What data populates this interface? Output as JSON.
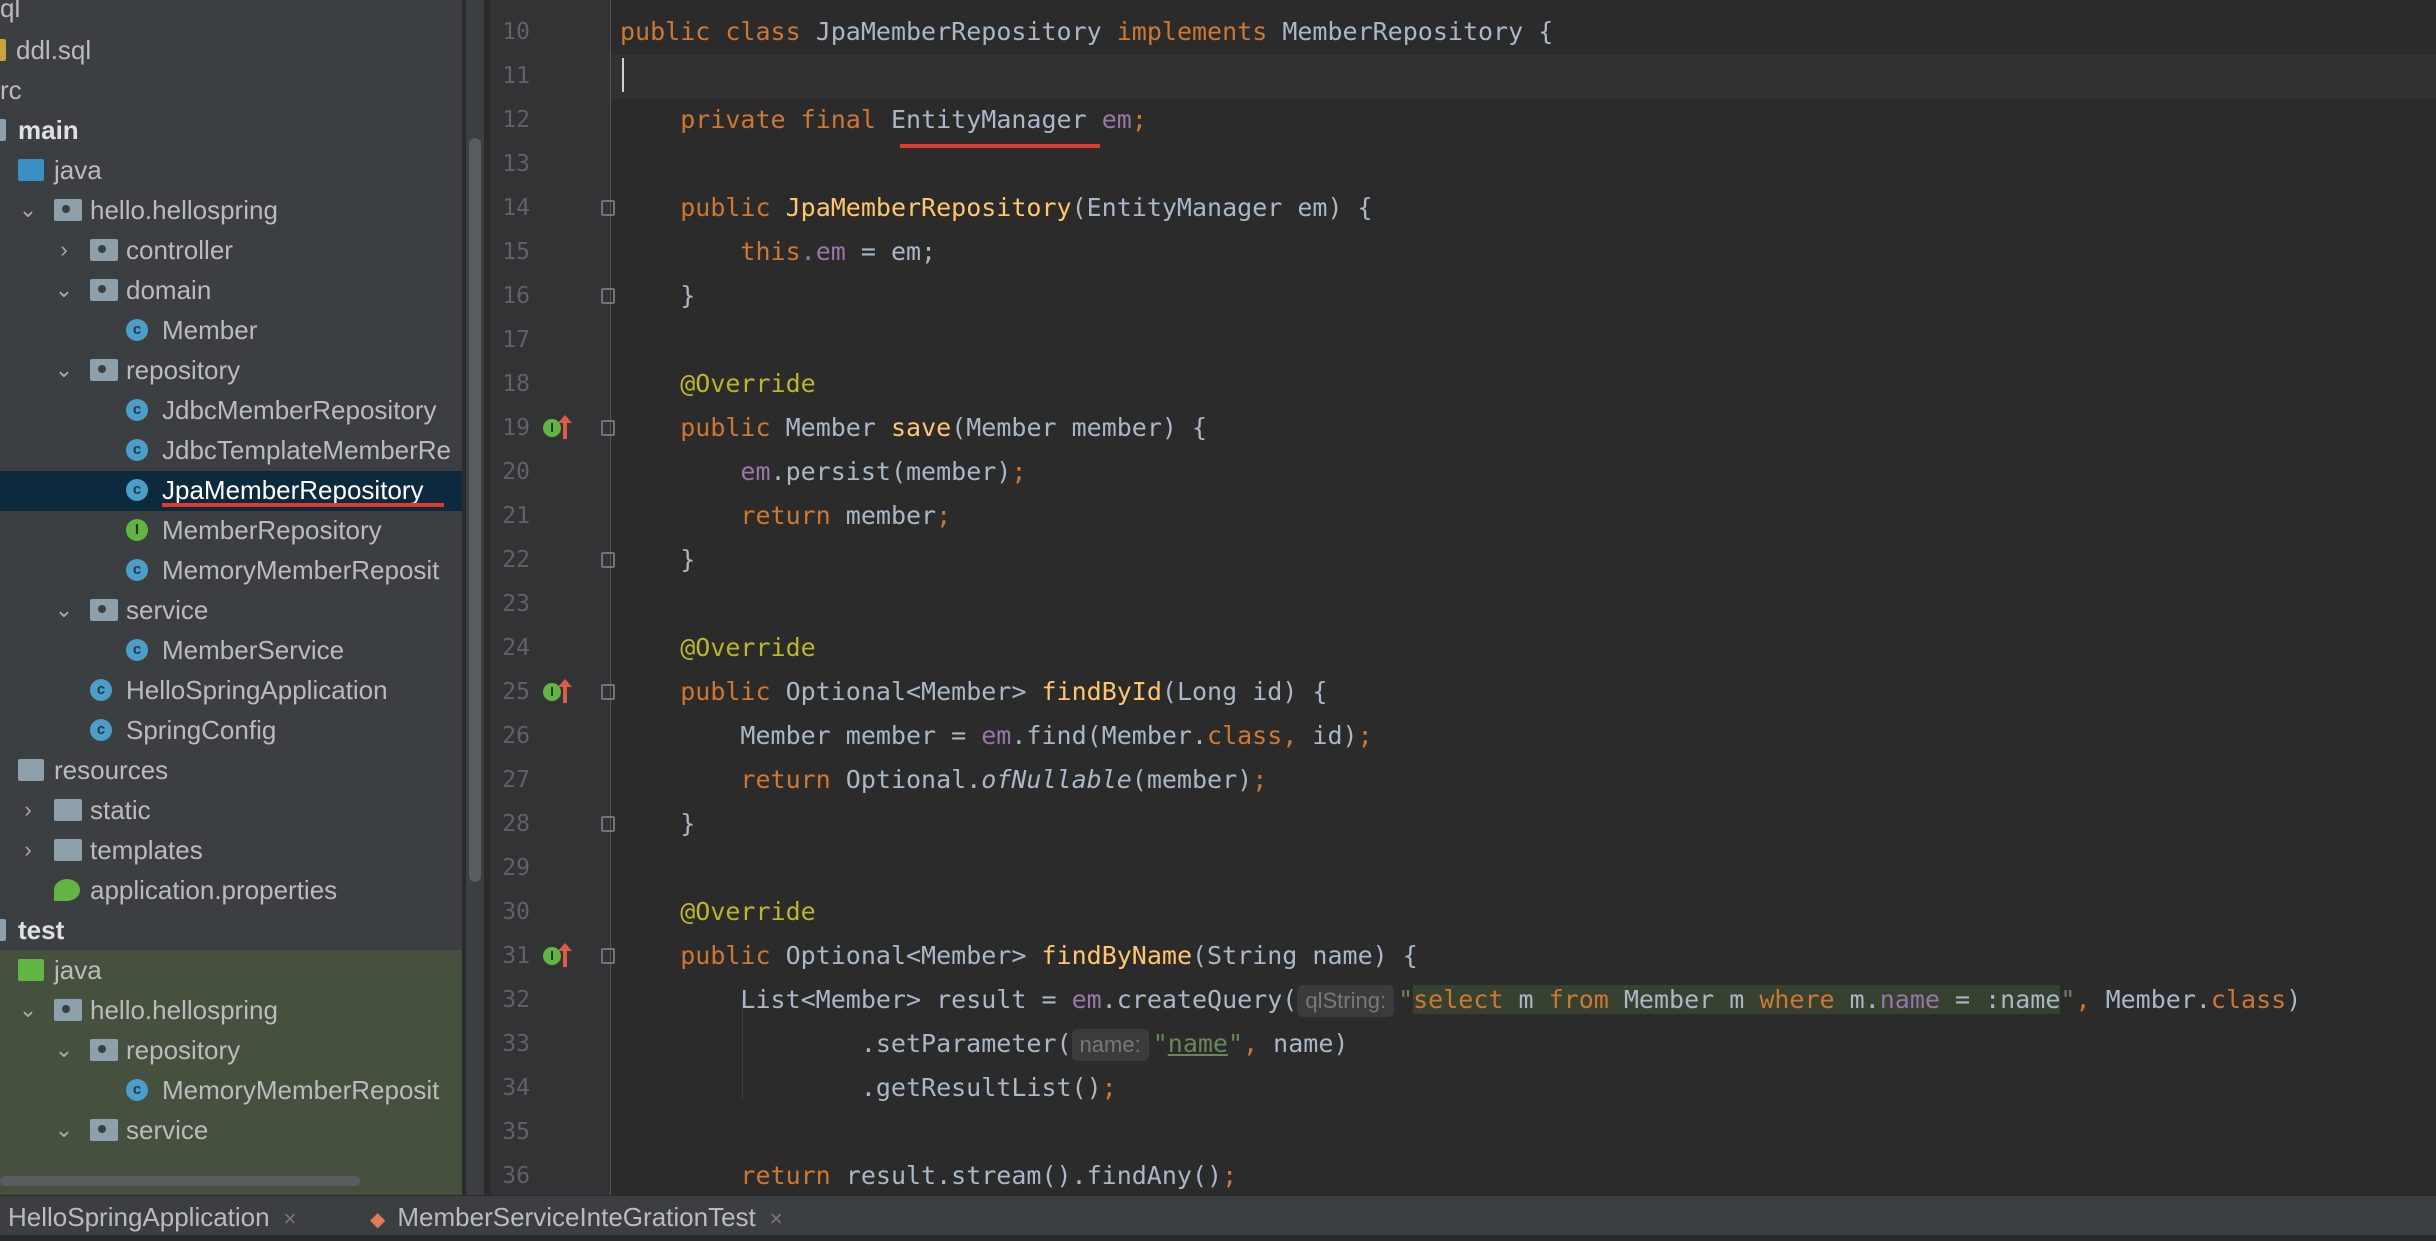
{
  "tree": {
    "items": [
      {
        "label": "ql"
      },
      {
        "label": "ddl.sql"
      },
      {
        "label": "rc"
      },
      {
        "label": "main"
      },
      {
        "label": "java"
      },
      {
        "label": "hello.hellospring"
      },
      {
        "label": "controller"
      },
      {
        "label": "domain"
      },
      {
        "label": "Member"
      },
      {
        "label": "repository"
      },
      {
        "label": "JdbcMemberRepository"
      },
      {
        "label": "JdbcTemplateMemberRe"
      },
      {
        "label": "JpaMemberRepository"
      },
      {
        "label": "MemberRepository"
      },
      {
        "label": "MemoryMemberReposit"
      },
      {
        "label": "service"
      },
      {
        "label": "MemberService"
      },
      {
        "label": "HelloSpringApplication"
      },
      {
        "label": "SpringConfig"
      },
      {
        "label": "resources"
      },
      {
        "label": "static"
      },
      {
        "label": "templates"
      },
      {
        "label": "application.properties"
      },
      {
        "label": "test"
      },
      {
        "label": "java"
      },
      {
        "label": "hello.hellospring"
      },
      {
        "label": "repository"
      },
      {
        "label": "MemoryMemberReposit"
      },
      {
        "label": "service"
      }
    ]
  },
  "editor": {
    "lines": [
      {
        "n": "10"
      },
      {
        "n": "11"
      },
      {
        "n": "12"
      },
      {
        "n": "13"
      },
      {
        "n": "14"
      },
      {
        "n": "15"
      },
      {
        "n": "16"
      },
      {
        "n": "17"
      },
      {
        "n": "18"
      },
      {
        "n": "19"
      },
      {
        "n": "20"
      },
      {
        "n": "21"
      },
      {
        "n": "22"
      },
      {
        "n": "23"
      },
      {
        "n": "24"
      },
      {
        "n": "25"
      },
      {
        "n": "26"
      },
      {
        "n": "27"
      },
      {
        "n": "28"
      },
      {
        "n": "29"
      },
      {
        "n": "30"
      },
      {
        "n": "31"
      },
      {
        "n": "32"
      },
      {
        "n": "33"
      },
      {
        "n": "34"
      },
      {
        "n": "35"
      },
      {
        "n": "36"
      }
    ],
    "t": {
      "public": "public",
      "class": "class",
      "classname": "JpaMemberRepository",
      "implements": "implements",
      "iface": "MemberRepository",
      "brace_open": " {",
      "brace_close": "}",
      "private": "private",
      "final": "final",
      "EntityManager": "EntityManager",
      "em": "em",
      "semi": ";",
      "ctor_params": "(EntityManager em) {",
      "this": "this",
      "dot_em": ".em",
      "assign_em": " = em;",
      "override": "@Override",
      "Member": "Member",
      "save": "save",
      "save_params": "(Member member) {",
      "persist": ".persist(member)",
      "return": "return",
      "member_semi": " member",
      "Optional_Member": "Optional<Member>",
      "findById": "findById",
      "findById_params": "(Long id) {",
      "member_decl": "Member member = ",
      "find_call": ".find(Member.",
      "class_kw": "class",
      "comma_id": ", id)",
      "optional_of": "Optional.",
      "ofNullable": "ofNullable",
      "member_arg": "(member)",
      "findByName": "findByName",
      "findByName_params": "(String name) {",
      "list_decl": "List<Member> result = ",
      "createQuery": ".createQuery(",
      "hint_qlString": "qlString:",
      "q_open": "\"",
      "q_select": "select",
      "q_m1": " m ",
      "q_from": "from",
      "q_member": " Member m ",
      "q_where": "where",
      "q_mdot": " m.",
      "q_name": "name",
      "q_rest": " = :name",
      "q_close": "\"",
      "comma": ", ",
      "member_dot": "Member.",
      "close_paren": ")",
      "setParameter": ".setParameter(",
      "hint_name": "name:",
      "s_q1": "\"",
      "s_name": "name",
      "s_q2": "\"",
      "name_arg": " name)",
      "getResultList": ".getResultList()",
      "return_stream": " result.stream().findAny()"
    }
  },
  "bottom_tabs": [
    {
      "label": "HelloSpringApplication",
      "close": "×"
    },
    {
      "label": "MemberServiceInteGrationTest",
      "close": "×"
    }
  ]
}
